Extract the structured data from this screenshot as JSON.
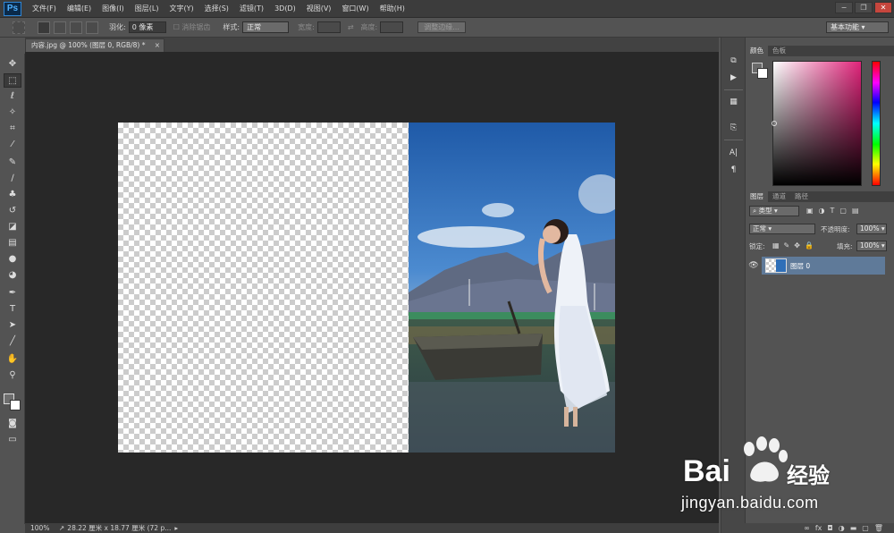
{
  "app": {
    "logo": "Ps"
  },
  "menu": [
    "文件(F)",
    "编辑(E)",
    "图像(I)",
    "图层(L)",
    "文字(Y)",
    "选择(S)",
    "滤镜(T)",
    "3D(D)",
    "视图(V)",
    "窗口(W)",
    "帮助(H)"
  ],
  "window_controls": [
    "−",
    "❐",
    "✕"
  ],
  "options": {
    "feather_label": "羽化:",
    "feather_value": "0 像素",
    "antialias_label": "消除锯齿",
    "style_label": "样式:",
    "style_value": "正常",
    "width_label": "宽度:",
    "height_label": "高度:",
    "refine_button": "调整边缘..."
  },
  "workspace": "基本功能",
  "document_tab": {
    "title": "内容.jpg @ 100% (图层 0, RGB/8) *",
    "close": "×"
  },
  "status": {
    "zoom": "100%",
    "info": "28.22 厘米 x 18.77 厘米 (72 p..."
  },
  "color_panel": {
    "tabs": [
      "颜色",
      "色板"
    ]
  },
  "layers_panel": {
    "tabs": [
      "图层",
      "通道",
      "路径"
    ],
    "filter_kind": "类型",
    "blend_mode": "正常",
    "opacity_label": "不透明度:",
    "opacity_value": "100%",
    "lock_label": "锁定:",
    "fill_label": "填充:",
    "fill_value": "100%",
    "layers": [
      {
        "name": "图层 0",
        "visible": true,
        "selected": true
      }
    ],
    "footer_icons": [
      "∞",
      "fx",
      "◘",
      "◑",
      "▬",
      "▢",
      "🗑"
    ]
  },
  "watermark": {
    "brand": "Bai",
    "brand_cn": "经验",
    "site": "jingyan.baidu.com"
  },
  "colors": {
    "accent_blue": "#2f86d6",
    "selected_layer": "#5f7a99",
    "canvas_bg": "#282828"
  }
}
